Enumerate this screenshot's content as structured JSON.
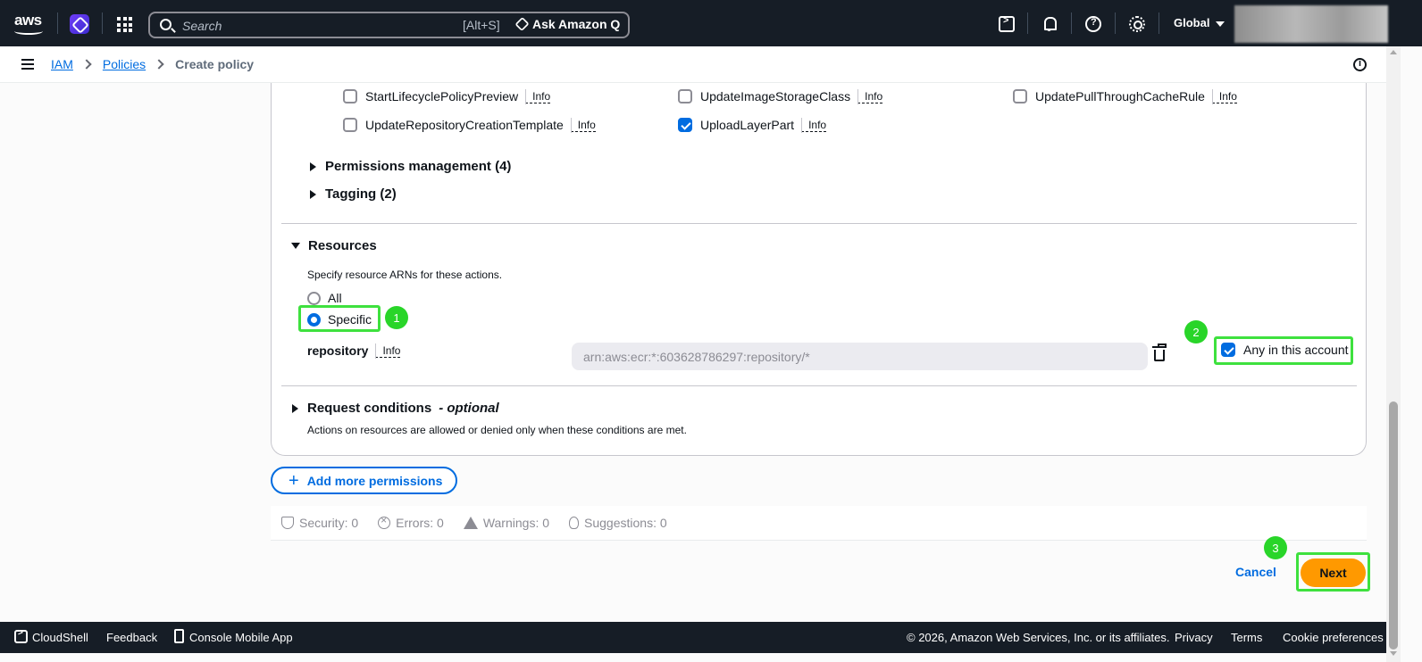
{
  "topnav": {
    "logo_text": "aws",
    "search_placeholder": "Search",
    "search_shortcut": "[Alt+S]",
    "ask_q_label": "Ask Amazon Q",
    "region_label": "Global",
    "icons": [
      "grid-icon",
      "search-icon",
      "cloudshell-icon",
      "bell-icon",
      "help-icon",
      "gear-icon"
    ]
  },
  "breadcrumb": {
    "items": [
      "IAM",
      "Policies"
    ],
    "current": "Create policy"
  },
  "actions": {
    "info_label": "Info",
    "rows": [
      [
        {
          "label": "StartLifecyclePolicyPreview",
          "checked": false
        },
        {
          "label": "UpdateImageStorageClass",
          "checked": false
        },
        {
          "label": "UpdatePullThroughCacheRule",
          "checked": false
        }
      ],
      [
        {
          "label": "UpdateRepositoryCreationTemplate",
          "checked": false
        },
        {
          "label": "UploadLayerPart",
          "checked": true
        }
      ]
    ]
  },
  "sections": {
    "permissions_management": "Permissions management (4)",
    "tagging": "Tagging (2)",
    "resources_title": "Resources",
    "resources_desc": "Specify resource ARNs for these actions.",
    "radio_all": "All",
    "radio_specific": "Specific",
    "selected_radio": "Specific",
    "resource_label": "repository",
    "resource_info": "Info",
    "arn_value": "arn:aws:ecr:*:603628786297:repository/*",
    "any_in_account_label": "Any in this account",
    "any_in_account_checked": true,
    "request_conditions_title": "Request conditions",
    "request_conditions_optional": "- optional",
    "request_conditions_desc": "Actions on resources are allowed or denied only when these conditions are met."
  },
  "add_permissions_label": "Add more permissions",
  "findings": {
    "security": "Security: 0",
    "errors": "Errors: 0",
    "warnings": "Warnings: 0",
    "suggestions": "Suggestions: 0"
  },
  "footer_buttons": {
    "cancel": "Cancel",
    "next": "Next"
  },
  "annotations": {
    "badge_1": "1",
    "badge_2": "2",
    "badge_3": "3",
    "highlight_color": "#3ee13e"
  },
  "footer": {
    "cloudshell": "CloudShell",
    "feedback": "Feedback",
    "mobile_app": "Console Mobile App",
    "copyright": "© 2026, Amazon Web Services, Inc. or its affiliates.",
    "privacy": "Privacy",
    "terms": "Terms",
    "cookie": "Cookie preferences"
  },
  "colors": {
    "nav_bg": "#161d26",
    "link_blue": "#006ce0",
    "primary_orange": "#ff9900"
  }
}
